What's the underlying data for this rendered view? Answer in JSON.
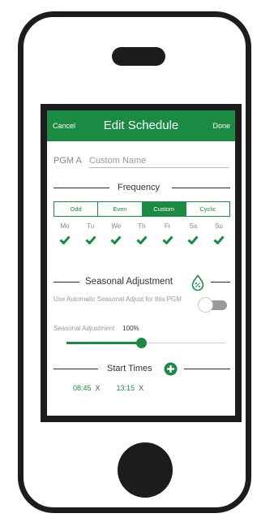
{
  "header": {
    "cancel_label": "Cancel",
    "title": "Edit Schedule",
    "done_label": "Done"
  },
  "pgm": {
    "label": "PGM A",
    "name_placeholder": "Custom Name"
  },
  "frequency": {
    "title": "Frequency",
    "options": [
      "Odd",
      "Even",
      "Custom",
      "Cyclic"
    ],
    "selected": "Custom",
    "days": [
      {
        "label": "Mo",
        "checked": true
      },
      {
        "label": "Tu",
        "checked": true
      },
      {
        "label": "We",
        "checked": true
      },
      {
        "label": "Th",
        "checked": true
      },
      {
        "label": "Fr",
        "checked": true
      },
      {
        "label": "Sa",
        "checked": true
      },
      {
        "label": "Su",
        "checked": true
      }
    ]
  },
  "seasonal": {
    "title": "Seasonal Adjustment",
    "icon": "percent-drop-icon",
    "toggle_label": "Use Automatic Seasonal Adjust for this PGM",
    "toggle_on": false,
    "adjustment_label": "Seasonal Adjustment",
    "adjustment_value": "100%",
    "slider_fraction": 0.47
  },
  "start_times": {
    "title": "Start Times",
    "add_icon": "plus-circle-icon",
    "items": [
      {
        "time": "08:45",
        "remove": "X"
      },
      {
        "time": "13:15",
        "remove": "X"
      }
    ]
  },
  "colors": {
    "accent": "#1b8a43",
    "frame": "#1c1c1c"
  }
}
